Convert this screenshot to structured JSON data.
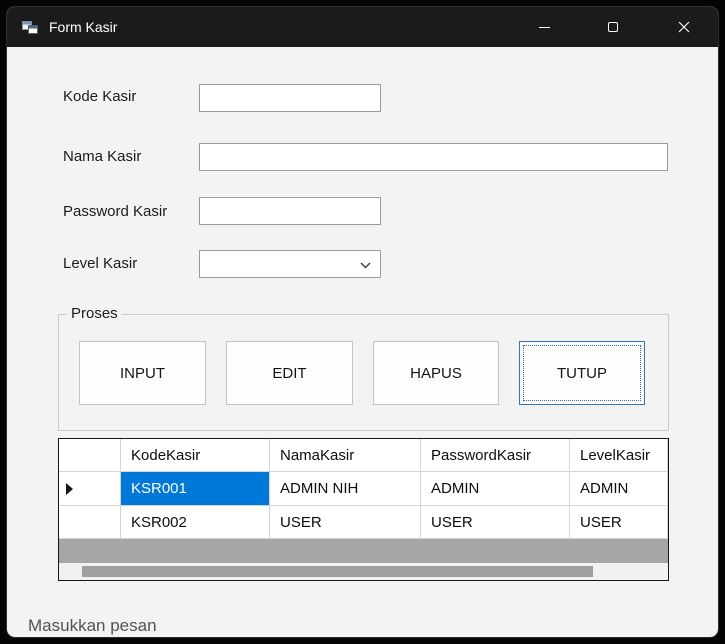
{
  "window": {
    "title": "Form Kasir"
  },
  "fields": {
    "kode": {
      "label": "Kode Kasir",
      "value": ""
    },
    "nama": {
      "label": "Nama Kasir",
      "value": ""
    },
    "password": {
      "label": "Password Kasir",
      "value": ""
    },
    "level": {
      "label": "Level Kasir",
      "value": ""
    }
  },
  "proses": {
    "title": "Proses",
    "buttons": [
      {
        "label": "INPUT"
      },
      {
        "label": "EDIT"
      },
      {
        "label": "HAPUS"
      },
      {
        "label": "TUTUP",
        "focused": true
      }
    ]
  },
  "grid": {
    "columns": [
      "KodeKasir",
      "NamaKasir",
      "PasswordKasir",
      "LevelKasir"
    ],
    "rows": [
      [
        "KSR001",
        "ADMIN NIH",
        "ADMIN",
        "ADMIN"
      ],
      [
        "KSR002",
        "USER",
        "USER",
        "USER"
      ]
    ],
    "selection": {
      "row": 0,
      "column": "KodeKasir",
      "value": "KSR001"
    }
  },
  "overlay": {
    "text": "Masukkan pesan"
  },
  "icons": {
    "app_icon": "winforms-window",
    "minimize_icon": "minimize-dash",
    "maximize_icon": "maximize-square",
    "close_icon": "close-x",
    "combo_chevron_icon": "chevron-down",
    "current_row_icon": "right-arrow"
  },
  "colors": {
    "selection": "#0078d7",
    "titlebar": "#1b1b1b",
    "body": "#f3f3f3",
    "grid_background": "#a6a6a6"
  }
}
